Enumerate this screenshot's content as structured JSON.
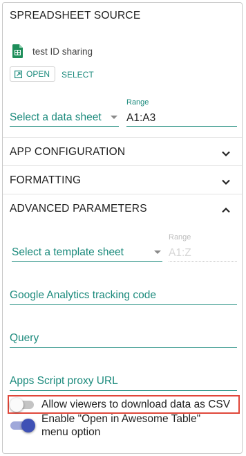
{
  "spreadsheet_source": {
    "title": "SPREADSHEET SOURCE",
    "file_name": "test ID sharing",
    "open_label": "OPEN",
    "select_label": "SELECT",
    "data_sheet_placeholder": "Select a data sheet",
    "range_label": "Range",
    "range_value": "A1:A3"
  },
  "sections": {
    "app_configuration": "APP CONFIGURATION",
    "formatting": "FORMATTING",
    "advanced_parameters": "ADVANCED PARAMETERS"
  },
  "advanced": {
    "template_sheet_placeholder": "Select a template sheet",
    "range_label": "Range",
    "range_value": "A1:Z",
    "analytics_label": "Google Analytics tracking code",
    "query_label": "Query",
    "proxy_label": "Apps Script proxy URL",
    "toggles": [
      {
        "label": "Allow viewers to download data as CSV",
        "on": false
      },
      {
        "label": "Enable \"Open in Awesome Table\" menu option",
        "on": true
      }
    ]
  },
  "colors": {
    "accent": "#1b8a7c",
    "toggle_on": "#3f51b5",
    "highlight": "#e0473a"
  }
}
